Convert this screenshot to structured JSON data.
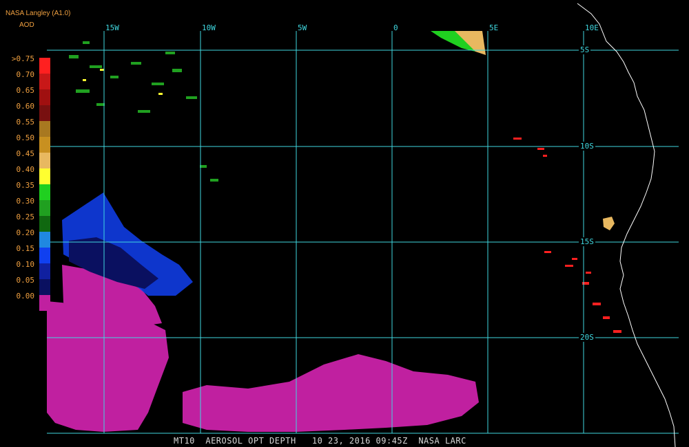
{
  "header": {
    "source": "NASA Langley (A1.0)",
    "product": "AOD"
  },
  "legend": {
    "labels": [
      ">0.75",
      "0.70",
      "0.65",
      "0.60",
      "0.55",
      "0.50",
      "0.45",
      "0.40",
      "0.35",
      "0.30",
      "0.25",
      "0.20",
      "0.15",
      "0.10",
      "0.05",
      "0.00"
    ],
    "colors": [
      "#ff2020",
      "#c81818",
      "#a01010",
      "#781010",
      "#a87820",
      "#c89020",
      "#e8b860",
      "#ffff30",
      "#20d020",
      "#20a020",
      "#106810",
      "#2088e0",
      "#1040f0",
      "#1020a0",
      "#0a1060",
      "#c020a0"
    ]
  },
  "map": {
    "lon_labels": [
      "15W",
      "10W",
      "5W",
      "0",
      "5E",
      "10E"
    ],
    "lat_labels": [
      "5S",
      "10S",
      "15S",
      "20S"
    ]
  },
  "footer": {
    "text": "MT10  AEROSOL OPT DEPTH   10 23, 2016 09:45Z  NASA LARC"
  },
  "colors": {
    "grid": "#40d8e0",
    "coast": "#ffffff",
    "label_orange": "#f0a040"
  }
}
